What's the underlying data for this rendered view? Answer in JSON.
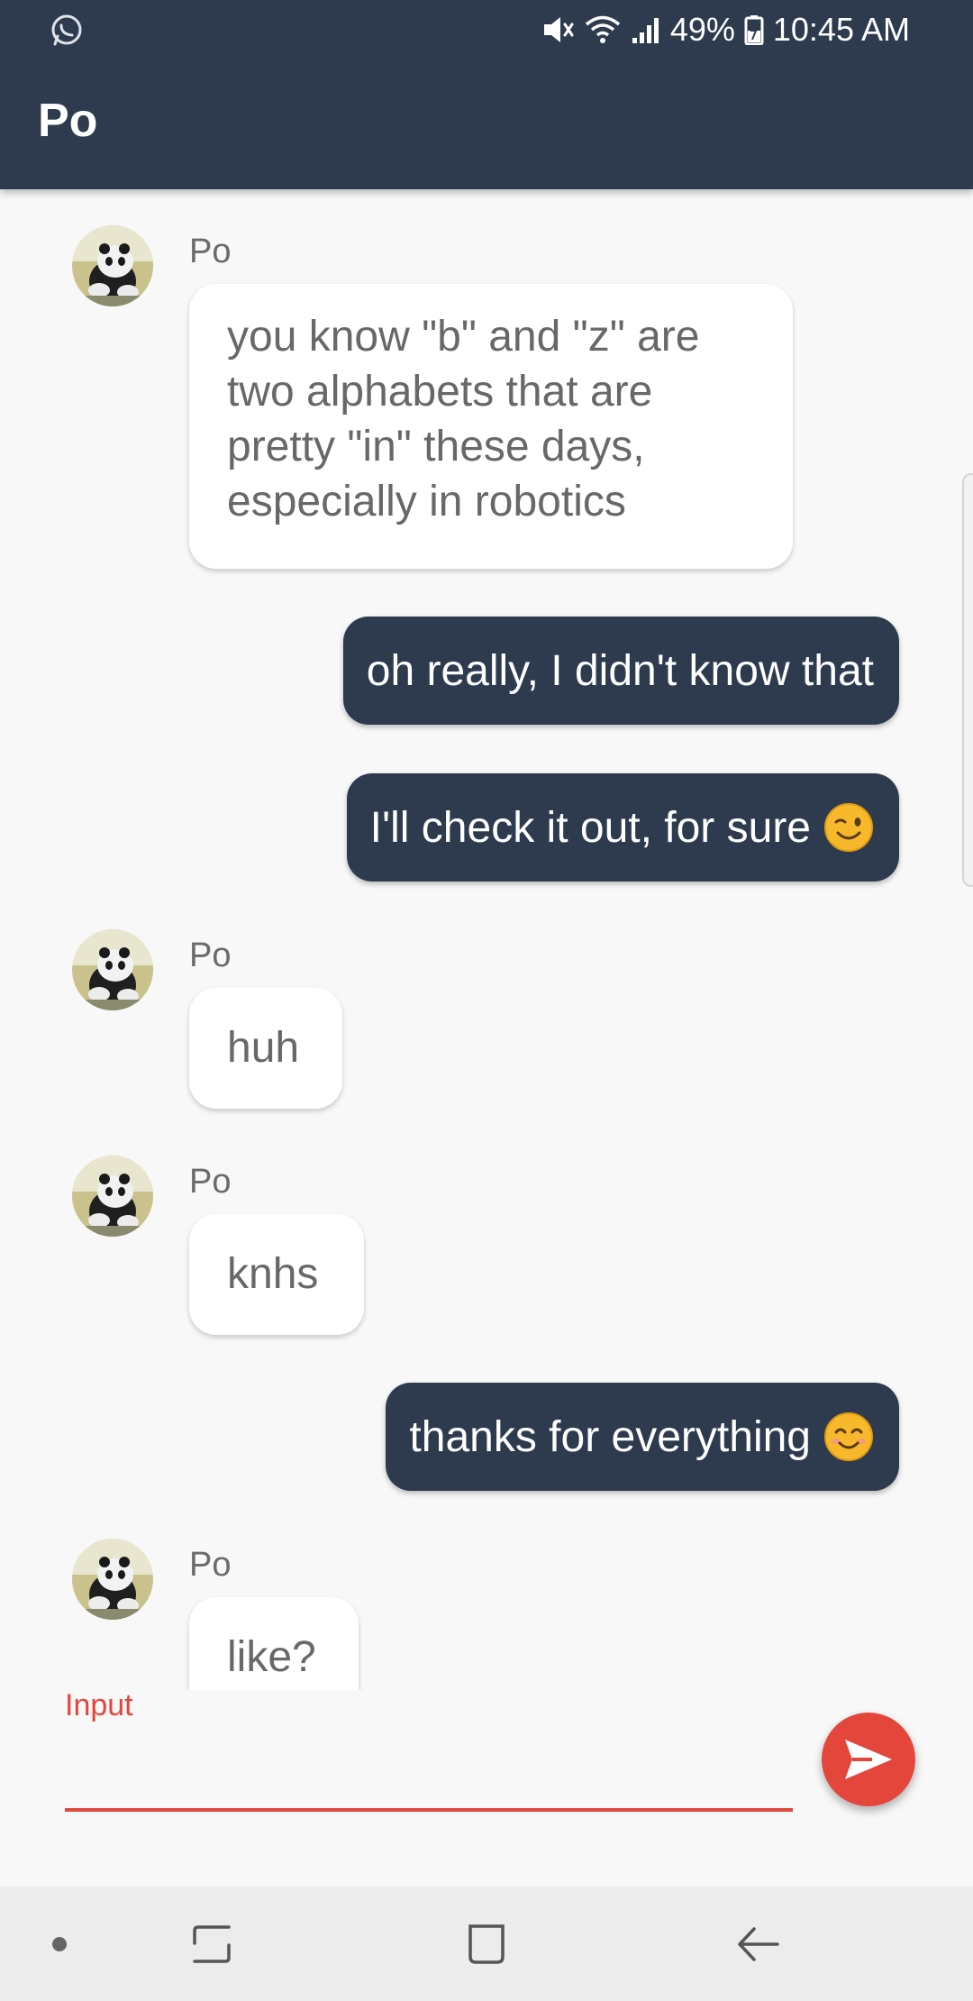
{
  "status_bar": {
    "battery": "49%",
    "time": "10:45 AM",
    "icons": [
      "whatsapp-icon",
      "mute-icon",
      "wifi-icon",
      "signal-icon",
      "battery-icon"
    ]
  },
  "app_bar": {
    "title": "Po"
  },
  "messages": [
    {
      "direction": "in",
      "sender": "Po",
      "text": "you know \"b\" and \"z\" are two alphabets that are pretty \"in\" these days, especially in robotics"
    },
    {
      "direction": "out",
      "text": "oh really, I didn't know that"
    },
    {
      "direction": "out",
      "text": "I'll check it out, for sure",
      "emoji": "wink-emoji"
    },
    {
      "direction": "in",
      "sender": "Po",
      "text": "huh"
    },
    {
      "direction": "in",
      "sender": "Po",
      "text": "knhs"
    },
    {
      "direction": "out",
      "text": "thanks for everything",
      "emoji": "smile-emoji"
    },
    {
      "direction": "in",
      "sender": "Po",
      "text": "like?"
    }
  ],
  "composer": {
    "label": "Input",
    "value": "",
    "send_icon": "send-icon"
  },
  "nav_bar": {
    "items": [
      "dot-icon",
      "recent-apps-icon",
      "home-icon",
      "back-icon"
    ]
  },
  "colors": {
    "primary": "#2e3b4e",
    "accent": "#e5463c",
    "incoming_bubble": "#ffffff",
    "outgoing_bubble": "#2e3b4e",
    "background": "#f8f8f8"
  }
}
